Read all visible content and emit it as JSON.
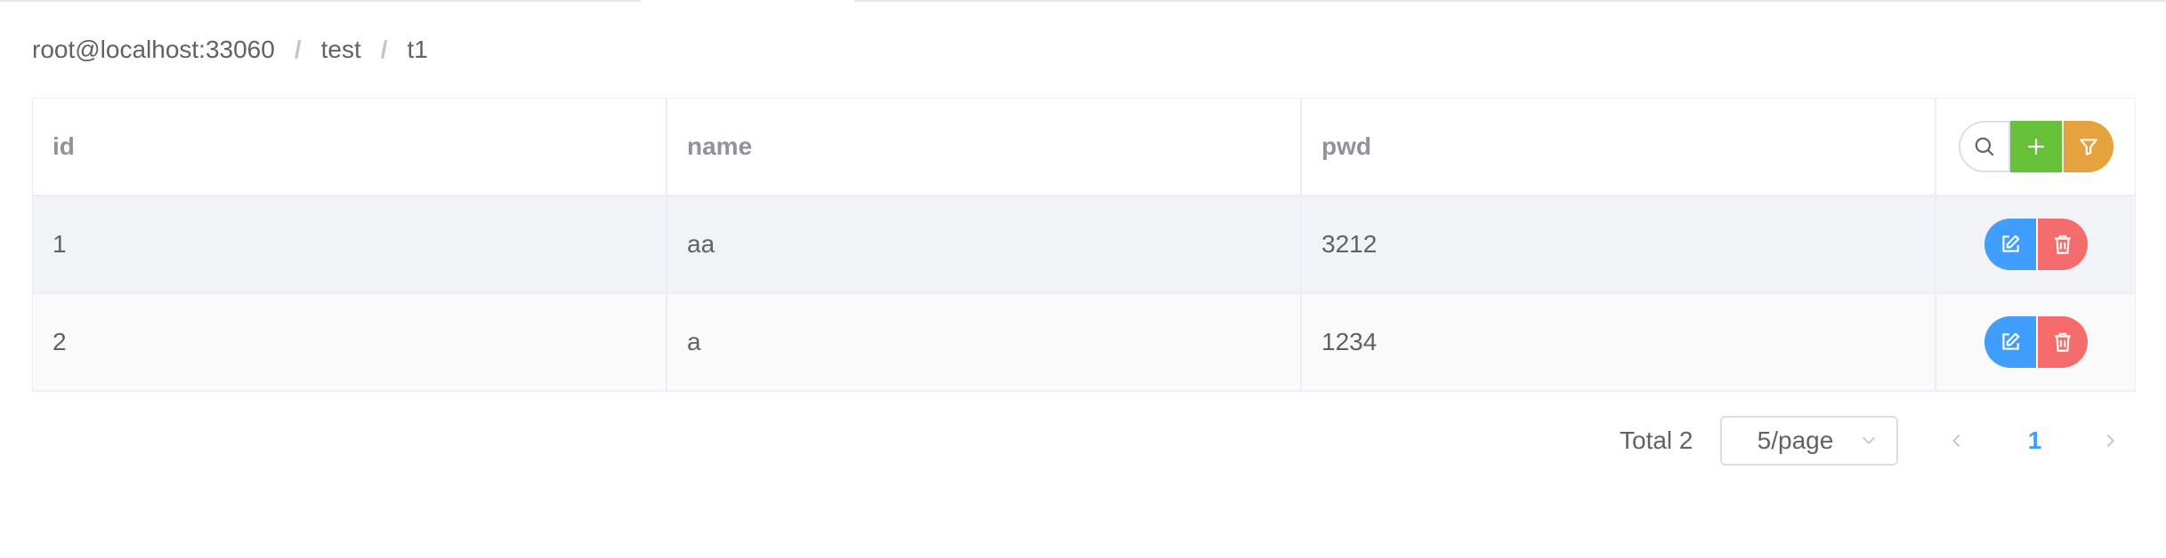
{
  "breadcrumb": {
    "connection": "root@localhost:33060",
    "database": "test",
    "table": "t1",
    "separator": "/"
  },
  "table": {
    "columns": [
      "id",
      "name",
      "pwd"
    ],
    "rows": [
      {
        "id": "1",
        "name": "aa",
        "pwd": "3212"
      },
      {
        "id": "2",
        "name": "a",
        "pwd": "1234"
      }
    ]
  },
  "toolbar_icons": [
    "search-icon",
    "plus-icon",
    "filter-icon"
  ],
  "row_action_icons": [
    "edit-icon",
    "delete-icon"
  ],
  "pagination": {
    "total": "Total 2",
    "page_size": "5/page",
    "current_page": "1"
  },
  "colors": {
    "primary": "#409eff",
    "success": "#67c23a",
    "warning": "#e6a23c",
    "danger": "#f56c6c"
  }
}
